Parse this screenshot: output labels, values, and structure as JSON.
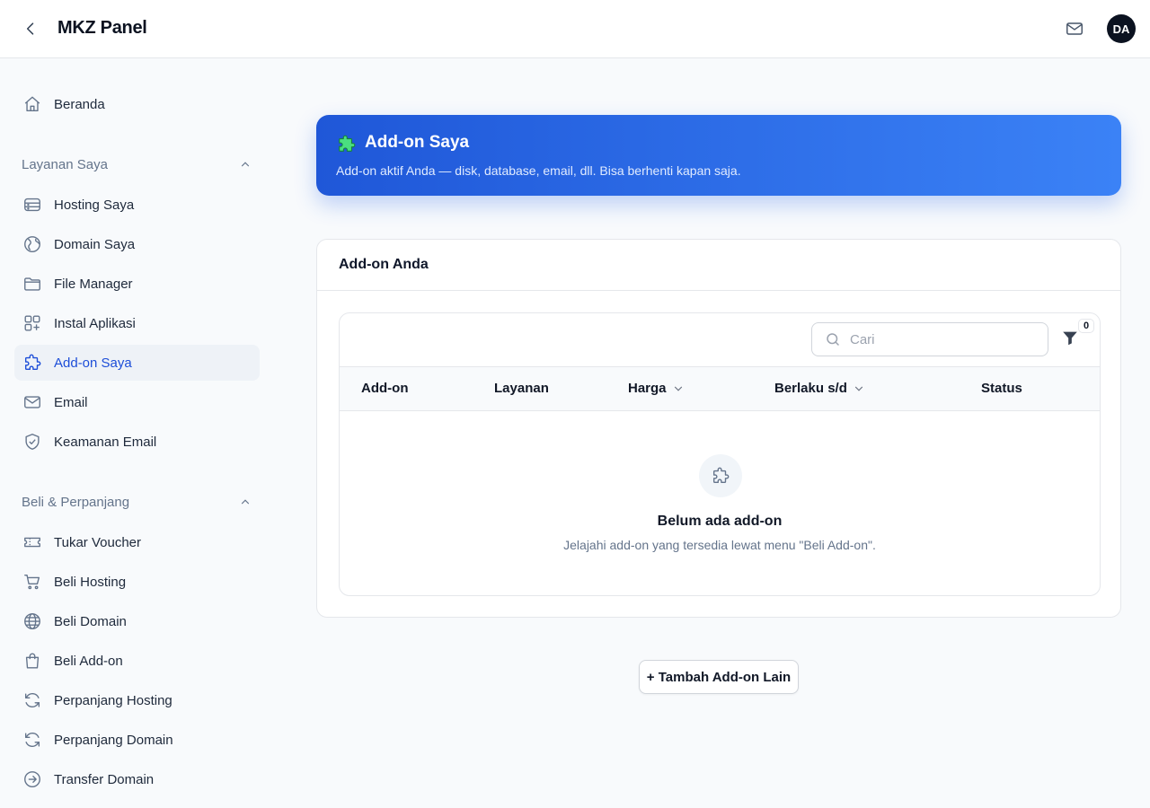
{
  "header": {
    "title": "MKZ Panel",
    "avatar_initials": "DA",
    "back_icon": "chevron-left-icon",
    "mail_icon": "mail-icon"
  },
  "sidebar": {
    "home": {
      "label": "Beranda",
      "icon": "home-icon"
    },
    "sections": [
      {
        "title": "Layanan Saya",
        "items": [
          {
            "label": "Hosting Saya",
            "icon": "server-icon"
          },
          {
            "label": "Domain Saya",
            "icon": "globe-icon"
          },
          {
            "label": "File Manager",
            "icon": "folder-icon"
          },
          {
            "label": "Instal Aplikasi",
            "icon": "apps-icon"
          },
          {
            "label": "Add-on Saya",
            "icon": "puzzle-icon",
            "active": true
          },
          {
            "label": "Email",
            "icon": "mail-icon"
          },
          {
            "label": "Keamanan Email",
            "icon": "shield-check-icon"
          }
        ]
      },
      {
        "title": "Beli & Perpanjang",
        "items": [
          {
            "label": "Tukar Voucher",
            "icon": "ticket-icon"
          },
          {
            "label": "Beli Hosting",
            "icon": "cart-icon"
          },
          {
            "label": "Beli Domain",
            "icon": "globe-icon"
          },
          {
            "label": "Beli Add-on",
            "icon": "shopping-bag-icon"
          },
          {
            "label": "Perpanjang Hosting",
            "icon": "refresh-icon"
          },
          {
            "label": "Perpanjang Domain",
            "icon": "refresh-icon"
          },
          {
            "label": "Transfer Domain",
            "icon": "arrow-circle-right-icon"
          }
        ]
      }
    ]
  },
  "banner": {
    "icon": "puzzle-emoji",
    "title": "Add-on Saya",
    "subtitle": "Add-on aktif Anda — disk, database, email, dll. Bisa berhenti kapan saja."
  },
  "card": {
    "title": "Add-on Anda",
    "search_placeholder": "Cari",
    "search_value": "",
    "filter_count": "0",
    "columns": [
      "Add-on",
      "Layanan",
      "Harga",
      "Berlaku s/d",
      "Status"
    ],
    "empty": {
      "title": "Belum ada add-on",
      "subtitle": "Jelajahi add-on yang tersedia lewat menu \"Beli Add-on\"."
    }
  },
  "actions": {
    "add_label": "+ Tambah Add-on Lain"
  },
  "colors": {
    "accent": "#1d4ed8",
    "banner_start": "#1f57d8",
    "banner_end": "#3b82f6",
    "sidebar_active_bg": "#eef2f7"
  }
}
